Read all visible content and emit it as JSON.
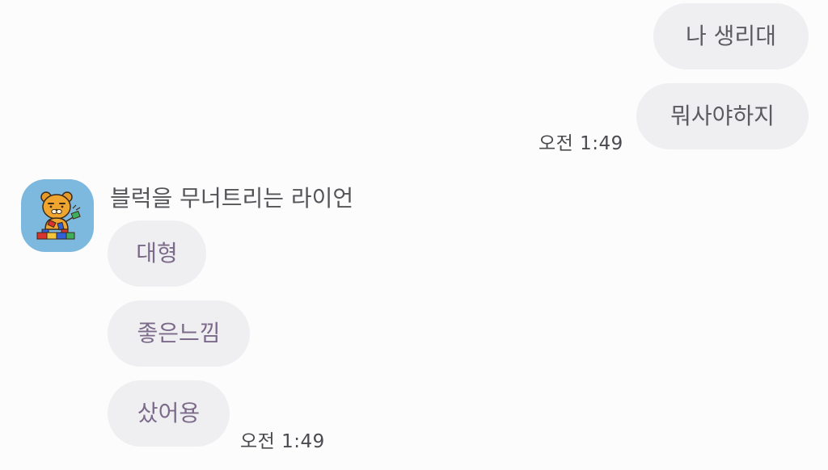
{
  "outgoing": {
    "messages": [
      {
        "text": "나 생리대"
      },
      {
        "text": "뭐사야하지"
      }
    ],
    "timestamp": "오전 1:49"
  },
  "incoming": {
    "sender_name": "블럭을 무너트리는 라이언",
    "avatar_icon": "ryan-character-avatar",
    "messages": [
      {
        "text": "대형"
      },
      {
        "text": "좋은느낌"
      },
      {
        "text": "샀어용"
      }
    ],
    "timestamp": "오전 1:49"
  },
  "colors": {
    "background": "#fcfcfd",
    "bubble": "#efeff1",
    "outgoing_text": "#5b5b60",
    "incoming_text": "#7c6a8a",
    "avatar_bg": "#7db8df"
  }
}
